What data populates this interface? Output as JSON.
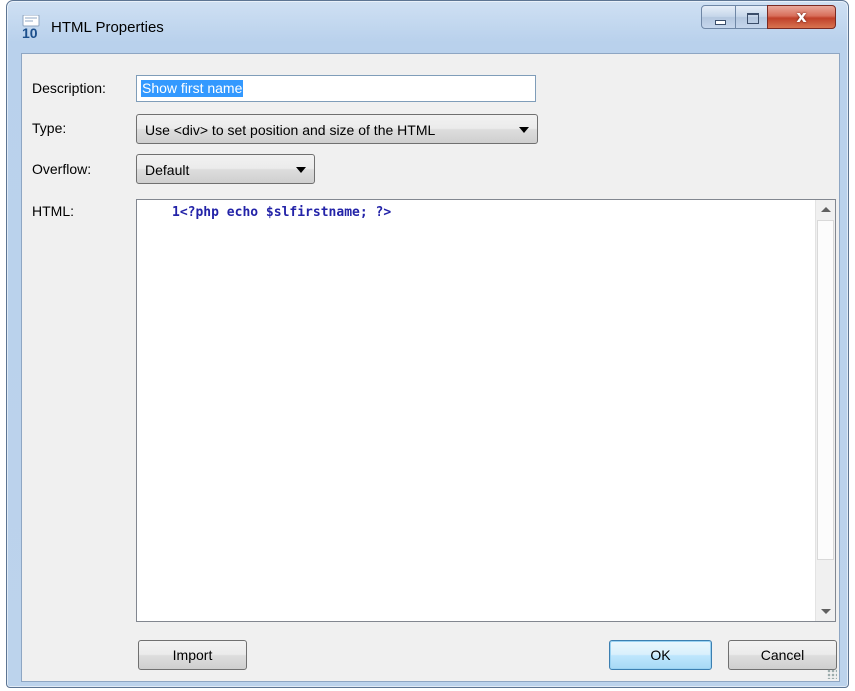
{
  "window": {
    "title": "HTML Properties",
    "icon": "app-10-icon",
    "icon_text": "10",
    "controls": {
      "minimize": "minimize-icon",
      "maximize": "maximize-icon",
      "close": "close-icon",
      "close_glyph": "x"
    }
  },
  "form": {
    "description": {
      "label": "Description:",
      "value": "Show first name"
    },
    "type": {
      "label": "Type:",
      "selected": "Use <div> to set position and size of the HTML"
    },
    "overflow": {
      "label": "Overflow:",
      "selected": "Default"
    },
    "html": {
      "label": "HTML:",
      "line_number": "1",
      "code": "<?php echo $slfirstname; ?>"
    }
  },
  "buttons": {
    "import": "Import",
    "ok": "OK",
    "cancel": "Cancel"
  },
  "colors": {
    "selection": "#3399ff",
    "code_text": "#2323a8",
    "close_button": "#c0412a",
    "ok_button_border": "#3c7fb1"
  }
}
